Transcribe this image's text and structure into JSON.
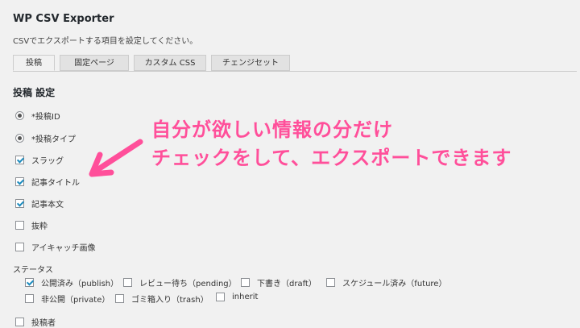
{
  "page": {
    "title": "WP CSV Exporter",
    "description": "CSVでエクスポートする項目を設定してください。"
  },
  "tabs": [
    {
      "label": "投稿",
      "active": true
    },
    {
      "label": "固定ページ",
      "active": false
    },
    {
      "label": "カスタム CSS",
      "active": false
    },
    {
      "label": "チェンジセット",
      "active": false
    }
  ],
  "section": {
    "title": "投稿 設定",
    "options": [
      {
        "label": "*投稿ID",
        "type": "radio",
        "checked": true
      },
      {
        "label": "*投稿タイプ",
        "type": "radio",
        "checked": true
      },
      {
        "label": "スラッグ",
        "type": "checkbox",
        "checked": true
      },
      {
        "label": "記事タイトル",
        "type": "checkbox",
        "checked": true
      },
      {
        "label": "記事本文",
        "type": "checkbox",
        "checked": true
      },
      {
        "label": "抜粋",
        "type": "checkbox",
        "checked": false
      },
      {
        "label": "アイキャッチ画像",
        "type": "checkbox",
        "checked": false
      }
    ]
  },
  "status": {
    "label": "ステータス",
    "items": [
      {
        "label": "公開済み（publish）",
        "checked": true
      },
      {
        "label": "レビュー待ち（pending）",
        "checked": false
      },
      {
        "label": "下書き（draft）",
        "checked": false
      },
      {
        "label": "スケジュール済み（future）",
        "checked": false
      },
      {
        "label": "非公開（private）",
        "checked": false
      },
      {
        "label": "ゴミ箱入り（trash）",
        "checked": false
      },
      {
        "label": "inherit",
        "checked": false
      }
    ]
  },
  "partial_option": {
    "label": "投稿者"
  },
  "annotation": {
    "line1": "自分が欲しい情報の分だけ",
    "line2": "チェックをして、エクスポートできます",
    "color": "#ff4f9a",
    "arrow_icon": "arrow-down-left-icon"
  }
}
